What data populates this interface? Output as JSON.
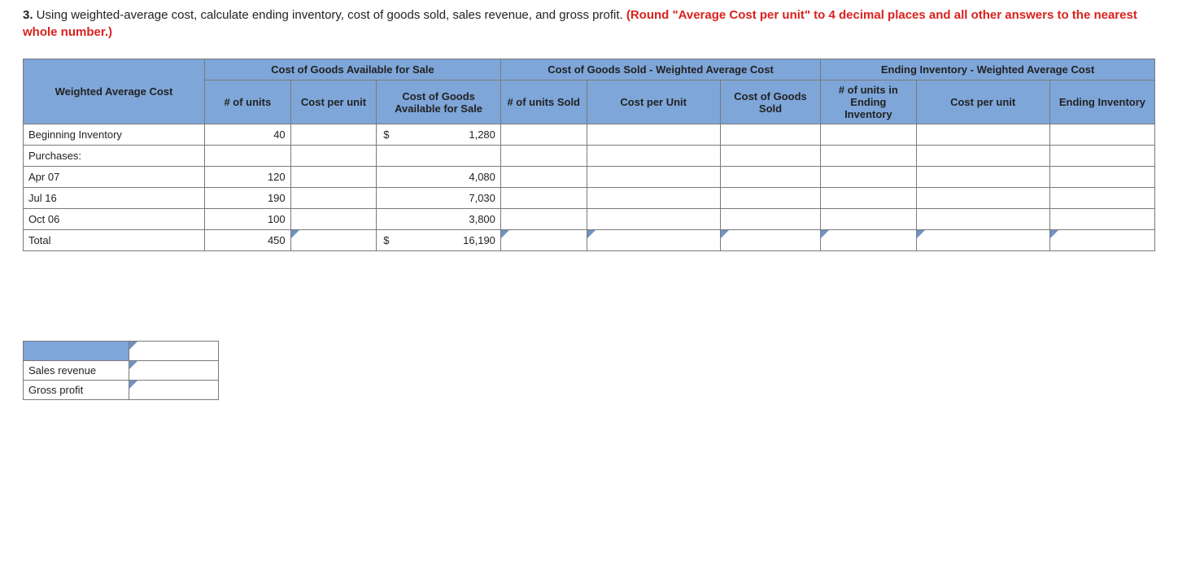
{
  "question": {
    "number": "3.",
    "text": " Using weighted-average cost, calculate ending inventory, cost of goods sold, sales revenue, and gross profit. ",
    "red": "(Round \"Average Cost per unit\" to 4 decimal places and all other answers to the nearest whole number.)"
  },
  "headers": {
    "rowhead": "Weighted Average Cost",
    "group1": "Cost of Goods Available for Sale",
    "group2": "Cost of Goods Sold - Weighted Average Cost",
    "group3": "Ending Inventory - Weighted Average Cost",
    "c1": "# of units",
    "c2": "Cost per unit",
    "c3": "Cost of Goods Available for Sale",
    "c4": "# of units Sold",
    "c5": "Cost per Unit",
    "c6": "Cost of Goods Sold",
    "c7": "# of units in Ending Inventory",
    "c8": "Cost per unit",
    "c9": "Ending Inventory"
  },
  "rows": {
    "beg": {
      "label": "Beginning Inventory",
      "units": "40",
      "cogas": "1,280",
      "dollar": "$"
    },
    "purch": {
      "label": "Purchases:"
    },
    "apr": {
      "label": "Apr 07",
      "units": "120",
      "cogas": "4,080"
    },
    "jul": {
      "label": "Jul 16",
      "units": "190",
      "cogas": "7,030"
    },
    "oct": {
      "label": "Oct 06",
      "units": "100",
      "cogas": "3,800"
    },
    "total": {
      "label": "Total",
      "units": "450",
      "cogas": "16,190",
      "dollar": "$"
    }
  },
  "summary": {
    "sales": "Sales revenue",
    "gross": "Gross profit"
  }
}
